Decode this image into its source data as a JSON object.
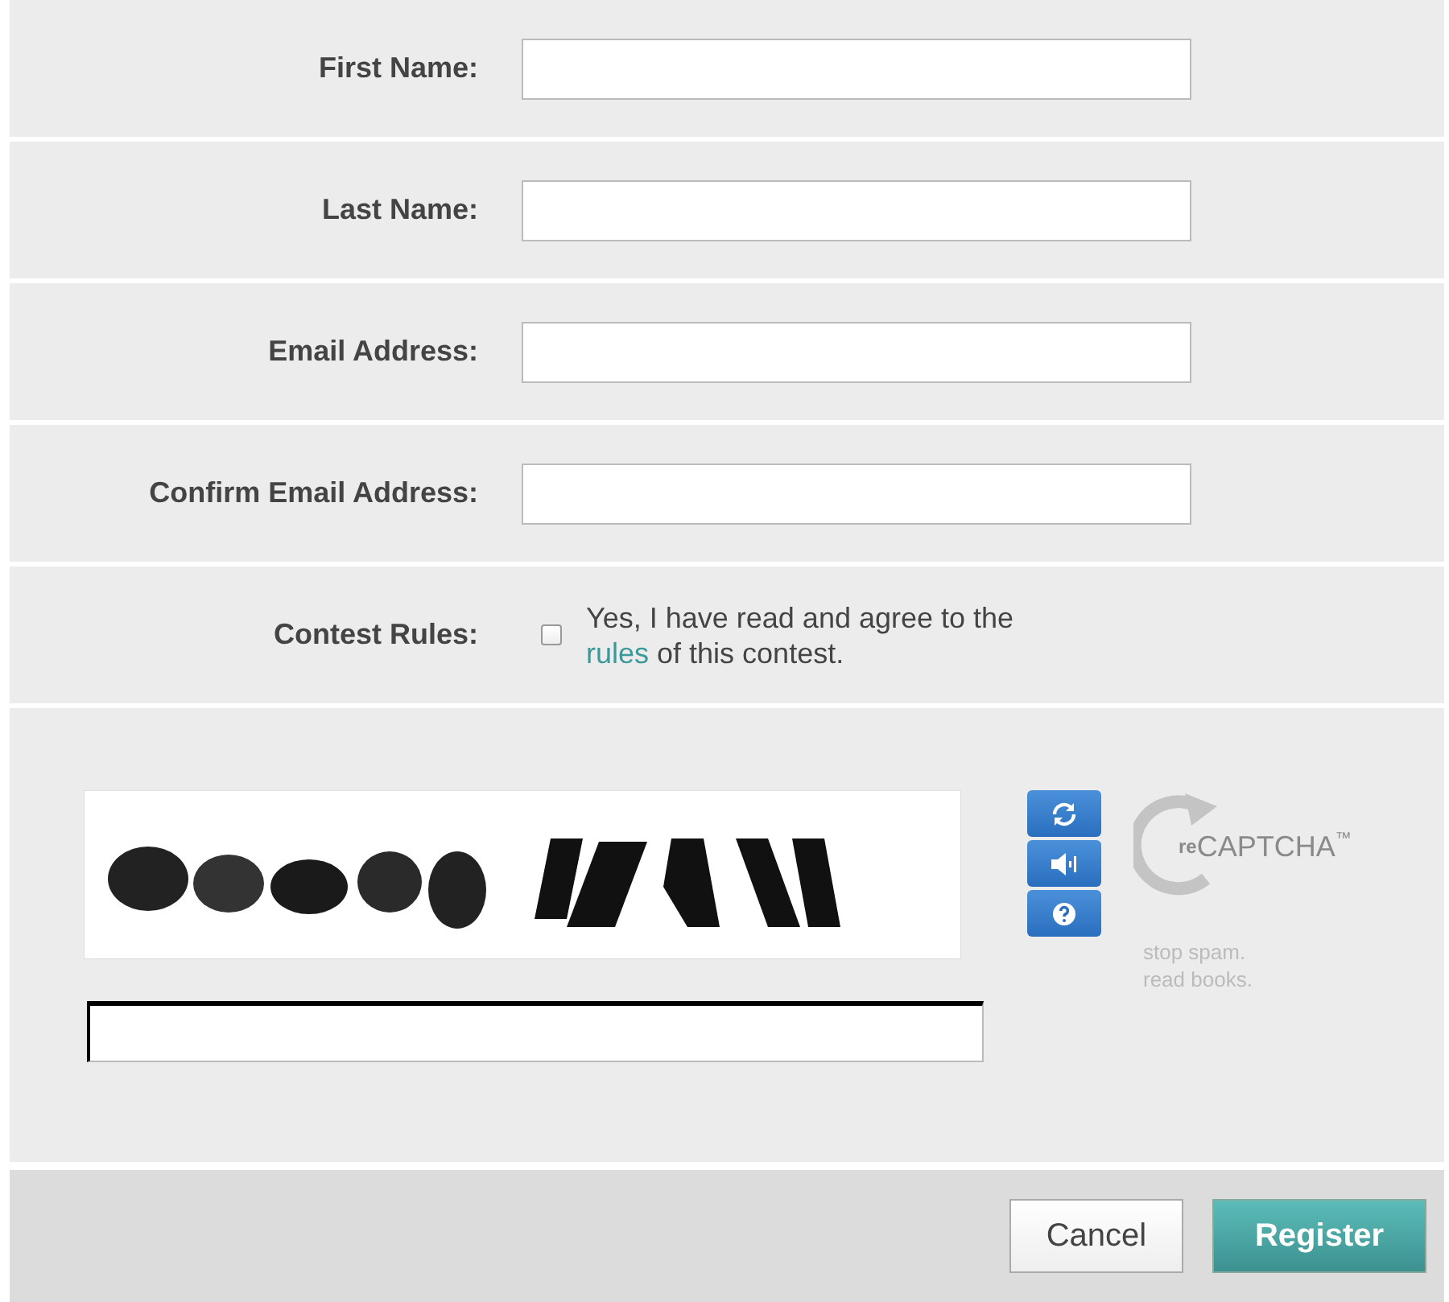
{
  "fields": [
    {
      "label": "First Name:"
    },
    {
      "label": "Last Name:"
    },
    {
      "label": "Email Address:"
    },
    {
      "label": "Confirm Email Address:"
    }
  ],
  "contest_rules": {
    "label": "Contest Rules:",
    "checked": false,
    "text_before": "Yes, I have read and agree to the",
    "link": "rules",
    "text_after": "of this contest."
  },
  "captcha": {
    "logo_prefix": "re",
    "logo_name": "CAPTCHA",
    "logo_mark": "™",
    "tagline_1": "stop spam.",
    "tagline_2": "read books."
  },
  "buttons": [
    {
      "label": "Cancel",
      "kind": "secondary"
    },
    {
      "label": "Register",
      "kind": "primary"
    }
  ]
}
